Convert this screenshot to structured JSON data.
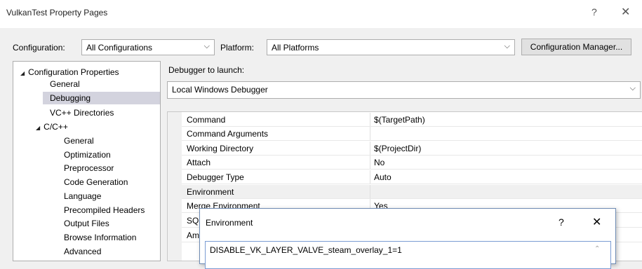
{
  "window": {
    "title": "VulkanTest Property Pages",
    "help_glyph": "?",
    "close_glyph": "✕"
  },
  "toolbar": {
    "configuration_label": "Configuration:",
    "configuration_value": "All Configurations",
    "platform_label": "Platform:",
    "platform_value": "All Platforms",
    "config_manager_button": "Configuration Manager...",
    "dropdown_glyph": "⌵"
  },
  "tree": {
    "expander_glyph": "◢",
    "items": [
      {
        "label": "Configuration Properties",
        "expanded": true
      },
      {
        "label": "General"
      },
      {
        "label": "Debugging",
        "selected": true
      },
      {
        "label": "VC++ Directories"
      },
      {
        "label": "C/C++",
        "expanded": true
      },
      {
        "label": "General"
      },
      {
        "label": "Optimization"
      },
      {
        "label": "Preprocessor"
      },
      {
        "label": "Code Generation"
      },
      {
        "label": "Language"
      },
      {
        "label": "Precompiled Headers"
      },
      {
        "label": "Output Files"
      },
      {
        "label": "Browse Information"
      },
      {
        "label": "Advanced"
      }
    ]
  },
  "debugger": {
    "label": "Debugger to launch:",
    "value": "Local Windows Debugger"
  },
  "properties": [
    {
      "name": "Command",
      "value": "$(TargetPath)"
    },
    {
      "name": "Command Arguments",
      "value": ""
    },
    {
      "name": "Working Directory",
      "value": "$(ProjectDir)"
    },
    {
      "name": "Attach",
      "value": "No"
    },
    {
      "name": "Debugger Type",
      "value": "Auto"
    },
    {
      "name": "Environment",
      "value": "",
      "selected": true
    },
    {
      "name": "Merge Environment",
      "value": "Yes"
    },
    {
      "name": "SQL",
      "value": ""
    },
    {
      "name": "Am",
      "value": ""
    }
  ],
  "environment_dialog": {
    "title": "Environment",
    "help_glyph": "?",
    "close_glyph": "✕",
    "value": "DISABLE_VK_LAYER_VALVE_steam_overlay_1=1"
  }
}
